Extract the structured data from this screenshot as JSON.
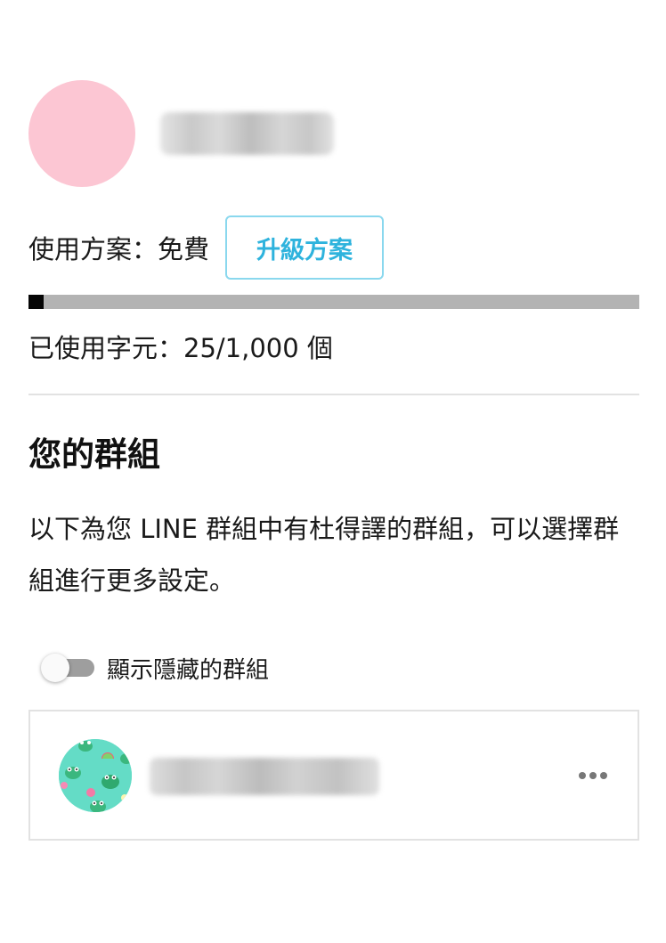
{
  "profile": {
    "avatar_color": "#fcc6d3",
    "name_blurred": true
  },
  "plan": {
    "label": "使用方案：免費",
    "upgrade_label": "升級方案",
    "accent_color": "#2eb3dd"
  },
  "usage": {
    "text": "已使用字元：25/1,000 個",
    "used": 25,
    "limit": 1000
  },
  "groups_section": {
    "title": "您的群組",
    "description": "以下為您 LINE 群組中有杜得譯的群組，可以選擇群組進行更多設定。",
    "toggle": {
      "label": "顯示隱藏的群組",
      "checked": false
    },
    "items": [
      {
        "name_blurred": true,
        "avatar_icon": "frog-pattern-avatar",
        "more_icon": "more-dots-icon"
      }
    ]
  }
}
